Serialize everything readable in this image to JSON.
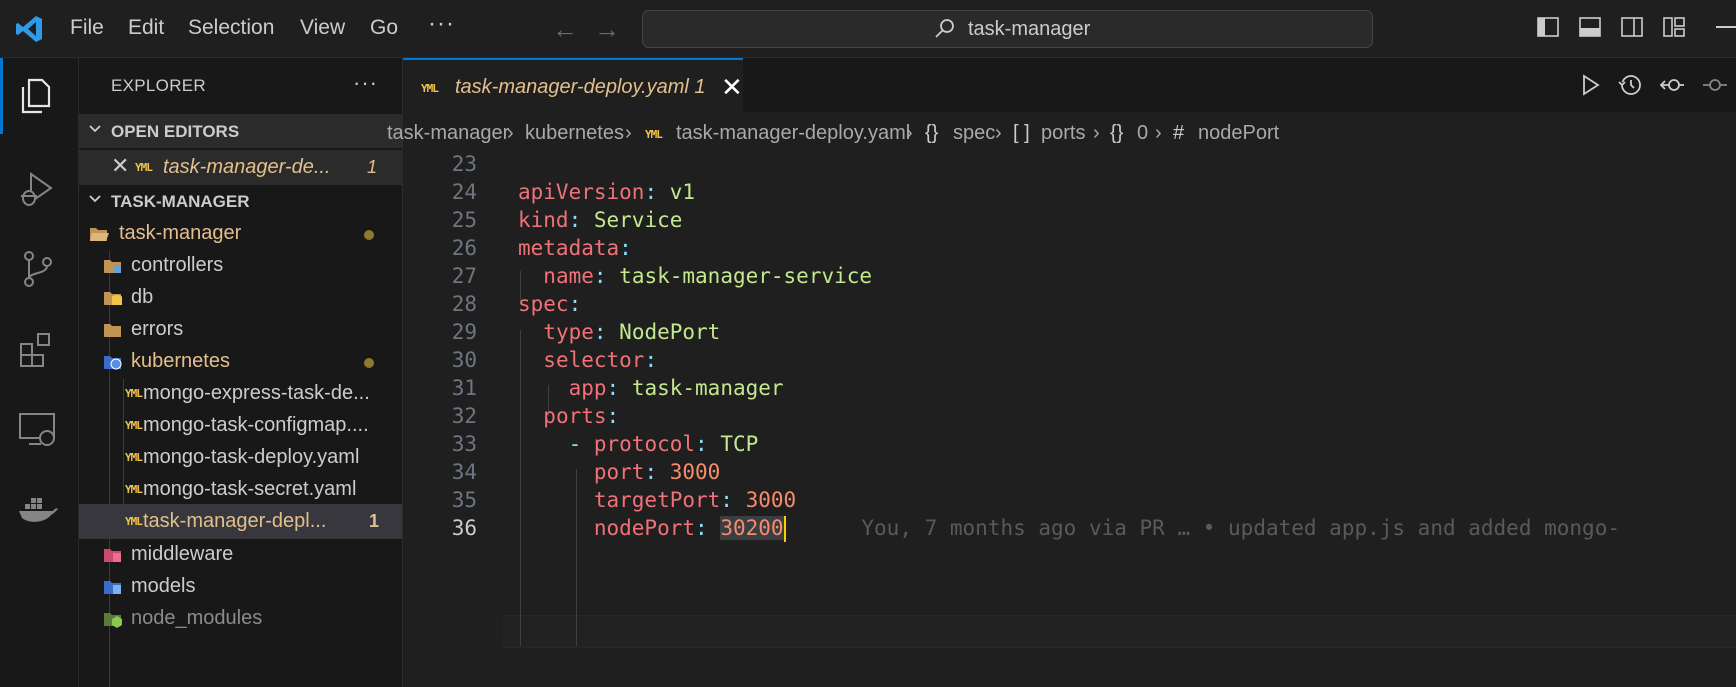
{
  "menu": [
    "File",
    "Edit",
    "Selection",
    "View",
    "Go",
    "···"
  ],
  "command_center": {
    "text": "task-manager"
  },
  "explorer": {
    "title": "EXPLORER",
    "more": "···",
    "open_editors": {
      "header": "OPEN EDITORS",
      "items": [
        {
          "label": "task-manager-de...",
          "badge": "1"
        }
      ]
    },
    "project": {
      "header": "TASK-MANAGER",
      "tree": [
        {
          "label": "task-manager",
          "icon": "folder-open-icon",
          "modified": true
        },
        {
          "label": "controllers",
          "icon": "controllers-folder-icon"
        },
        {
          "label": "db",
          "icon": "db-folder-icon"
        },
        {
          "label": "errors",
          "icon": "folder-icon"
        },
        {
          "label": "kubernetes",
          "icon": "kubernetes-folder-icon",
          "modified": true
        },
        {
          "label": "mongo-express-task-de...",
          "icon": "yaml-icon"
        },
        {
          "label": "mongo-task-configmap....",
          "icon": "yaml-icon"
        },
        {
          "label": "mongo-task-deploy.yaml",
          "icon": "yaml-icon"
        },
        {
          "label": "mongo-task-secret.yaml",
          "icon": "yaml-icon"
        },
        {
          "label": "task-manager-depl...",
          "icon": "yaml-icon",
          "badge": "1"
        },
        {
          "label": "middleware",
          "icon": "middleware-folder-icon"
        },
        {
          "label": "models",
          "icon": "models-folder-icon"
        },
        {
          "label": "node_modules",
          "icon": "node-folder-icon"
        }
      ]
    }
  },
  "editor": {
    "tab": {
      "label": "task-manager-deploy.yaml",
      "badge": "1"
    },
    "breadcrumbs": [
      "task-manager",
      "kubernetes",
      "task-manager-deploy.yaml",
      "spec",
      "ports",
      "0",
      "nodePort"
    ],
    "lines": [
      {
        "n": "23"
      },
      {
        "n": "24"
      },
      {
        "n": "25"
      },
      {
        "n": "26"
      },
      {
        "n": "27"
      },
      {
        "n": "28"
      },
      {
        "n": "29"
      },
      {
        "n": "30"
      },
      {
        "n": "31"
      },
      {
        "n": "32"
      },
      {
        "n": "33"
      },
      {
        "n": "34"
      },
      {
        "n": "35"
      },
      {
        "n": "36"
      }
    ],
    "code": {
      "l24": {
        "key": "apiVersion",
        "value": "v1"
      },
      "l25": {
        "key": "kind",
        "value": "Service"
      },
      "l26": {
        "key": "metadata"
      },
      "l27": {
        "key": "name",
        "value": "task-manager-service"
      },
      "l28": {
        "key": "spec"
      },
      "l29": {
        "key": "type",
        "value": "NodePort"
      },
      "l30": {
        "key": "selector"
      },
      "l31": {
        "key": "app",
        "value": "task-manager"
      },
      "l32": {
        "key": "ports"
      },
      "l33": {
        "key": "protocol",
        "value": "TCP"
      },
      "l34": {
        "key": "port",
        "value": "3000"
      },
      "l35": {
        "key": "targetPort",
        "value": "3000"
      },
      "l36": {
        "key": "nodePort",
        "value": "30200"
      }
    },
    "blame": "You, 7 months ago via PR … • updated app.js and added mongo-"
  },
  "colors": {
    "accent": "#0078d4",
    "modified": "#e2c08d",
    "yaml_key": "#f07178",
    "yaml_string": "#c3e88d",
    "yaml_number": "#f78c6c"
  }
}
